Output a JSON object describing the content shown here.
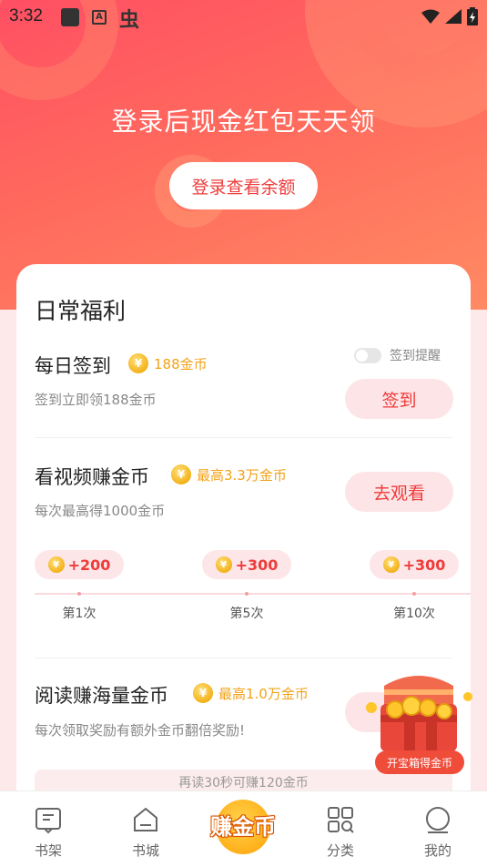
{
  "status_bar": {
    "time": "3:32",
    "notif_letter": "A",
    "notif_glyph": "虫"
  },
  "hero": {
    "title": "登录后现金红包天天领",
    "login_button": "登录查看余额"
  },
  "card": {
    "title": "日常福利",
    "checkin": {
      "title": "每日签到",
      "badge": "188金币",
      "subtitle": "签到立即领188金币",
      "reminder_label": "签到提醒",
      "reminder_on": false,
      "button": "签到"
    },
    "video": {
      "title": "看视频赚金币",
      "badge": "最高3.3万金币",
      "subtitle": "每次最高得1000金币",
      "button": "去观看",
      "steps": [
        {
          "reward": "+200",
          "label": "第1次"
        },
        {
          "reward": "+300",
          "label": "第5次"
        },
        {
          "reward": "+300",
          "label": "第10次"
        }
      ]
    },
    "reading": {
      "title": "阅读赚海量金币",
      "badge": "最高1.0万金币",
      "subtitle": "每次领取奖励有额外金币翻倍奖励!",
      "hint": "再读30秒可赚120金币"
    }
  },
  "treasure_chest": {
    "label": "开宝箱得金币"
  },
  "coin_glyph": "¥",
  "tabbar": {
    "items": [
      {
        "label": "书架",
        "icon": "bookshelf-icon"
      },
      {
        "label": "书城",
        "icon": "bookstore-icon"
      },
      {
        "label": "赚金币",
        "icon": "earn-coins-icon"
      },
      {
        "label": "分类",
        "icon": "category-icon"
      },
      {
        "label": "我的",
        "icon": "profile-icon"
      }
    ],
    "active_index": 2
  },
  "colors": {
    "accent": "#ee3b3b",
    "gold": "#f2a21a",
    "hero_start": "#ff4f63",
    "hero_end": "#ff8a63"
  }
}
